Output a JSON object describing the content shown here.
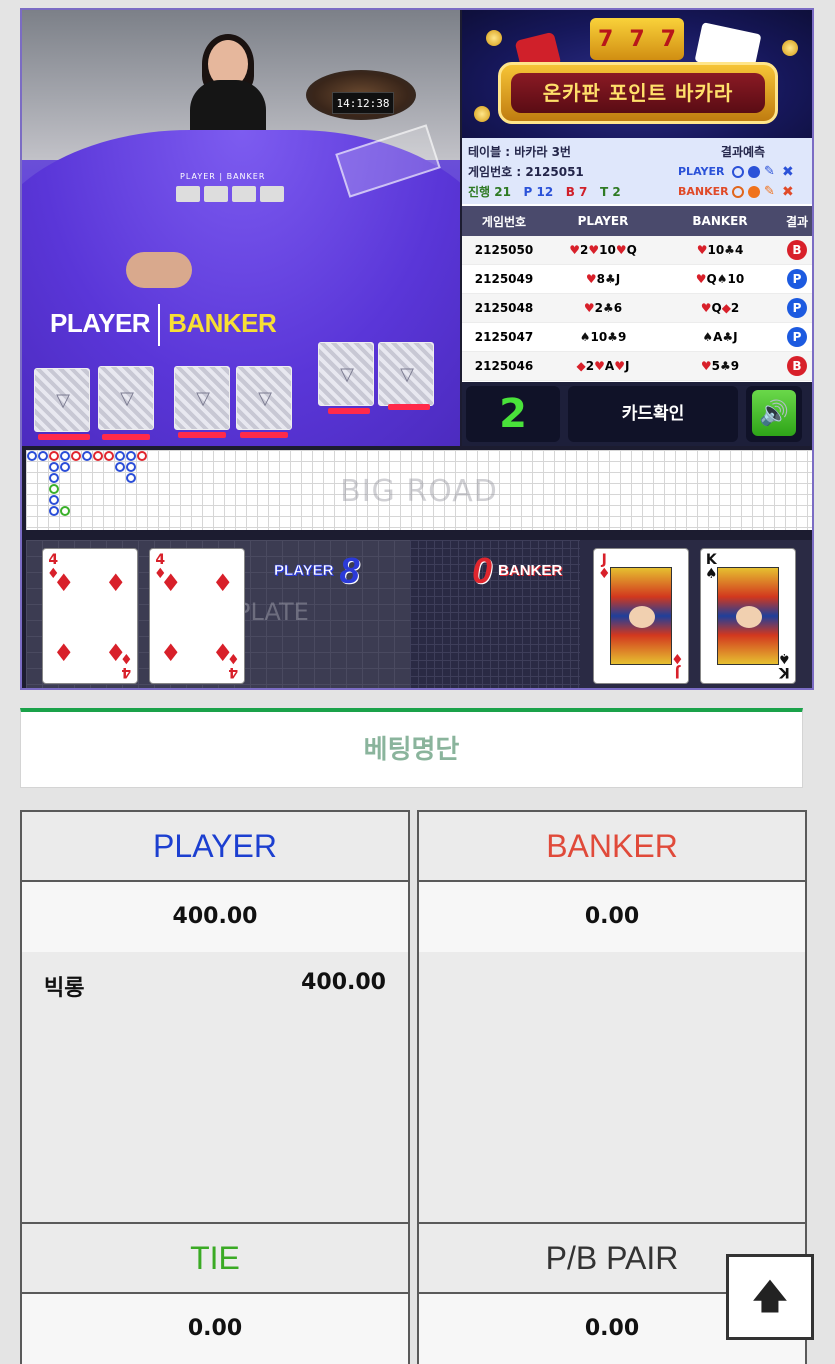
{
  "video": {
    "clock": "14:12:38",
    "mini_table_label": "PLAYER | BANKER",
    "player_label": "PLAYER",
    "banker_label": "BANKER"
  },
  "banner": {
    "slot_symbols": [
      "7",
      "7",
      "7"
    ],
    "title": "온카판 포인트 바카라"
  },
  "info": {
    "table": "테이블 : 바카라 3번",
    "game_no": "게임번호 : 2125051",
    "progress_label": "진행 21",
    "progress_p": "P 12",
    "progress_b": "B 7",
    "progress_t": "T 2",
    "prediction_title": "결과예측",
    "pred_player": "PLAYER",
    "pred_banker": "BANKER"
  },
  "history": {
    "headers": [
      "게임번호",
      "PLAYER",
      "BANKER",
      "결과"
    ],
    "rows": [
      {
        "game": "2125050",
        "player": "♥2♥10♥Q",
        "banker": "♥10♣4",
        "result": "B"
      },
      {
        "game": "2125049",
        "player": "♥8♣J",
        "banker": "♥Q♠10",
        "result": "P"
      },
      {
        "game": "2125048",
        "player": "♥2♣6",
        "banker": "♥Q◆2",
        "result": "P"
      },
      {
        "game": "2125047",
        "player": "♠10♣9",
        "banker": "♠A♣J",
        "result": "P"
      },
      {
        "game": "2125046",
        "player": "◆2♥A♥J",
        "banker": "♥5♣9",
        "result": "B"
      }
    ]
  },
  "controls": {
    "count": "2",
    "card_check": "카드확인",
    "sound_icon": "speaker-icon"
  },
  "big_road": {
    "watermark": "BIG ROAD"
  },
  "result_area": {
    "plate_watermark": "PLATE",
    "player_label": "PLAYER",
    "player_score": "8",
    "banker_label": "BANKER",
    "banker_score": "0",
    "player_cards": [
      {
        "rank": "4",
        "suit": "♦"
      },
      {
        "rank": "4",
        "suit": "♦"
      }
    ],
    "banker_cards": [
      {
        "rank": "J",
        "suit": "♦"
      },
      {
        "rank": "K",
        "suit": "♠"
      }
    ]
  },
  "bets": {
    "title": "베팅명단",
    "player": {
      "label": "PLAYER",
      "total": "400.00",
      "entries": [
        {
          "name": "빅롱",
          "amount": "400.00"
        }
      ]
    },
    "banker": {
      "label": "BANKER",
      "total": "0.00"
    },
    "tie": {
      "label": "TIE",
      "total": "0.00"
    },
    "pair": {
      "label": "P/B PAIR",
      "total": "0.00"
    }
  },
  "colors": {
    "player": "#1c3fd0",
    "banker": "#e04a3a",
    "tie": "#3aaa24",
    "accent_green": "#1aa24a"
  },
  "scroll_top_icon": "arrow-up-icon"
}
